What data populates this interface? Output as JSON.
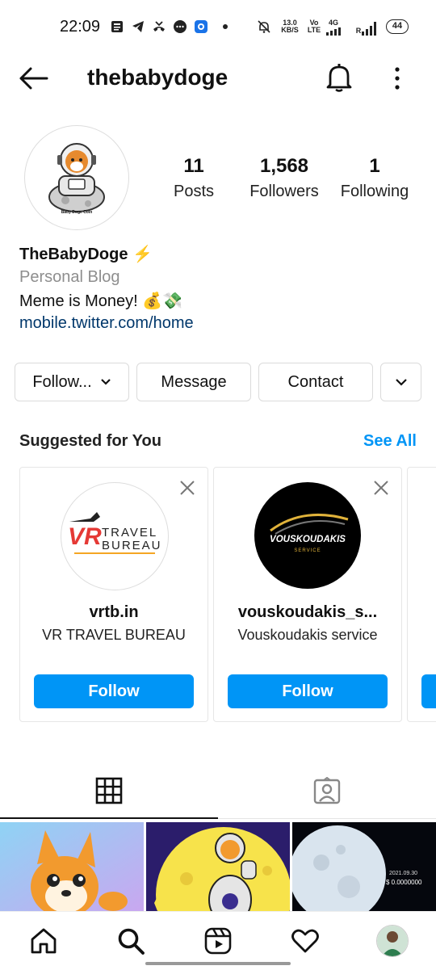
{
  "status_bar": {
    "time": "22:09",
    "speed_value": "13.0",
    "speed_unit": "KB/S",
    "volte_top": "Vo",
    "volte_bottom": "LTE",
    "net": "4G",
    "roaming": "R",
    "battery": "44"
  },
  "header": {
    "username": "thebabydoge"
  },
  "profile": {
    "avatar_caption": "Baby Doge Coin",
    "stats": [
      {
        "number": "11",
        "label": "Posts"
      },
      {
        "number": "1,568",
        "label": "Followers"
      },
      {
        "number": "1",
        "label": "Following"
      }
    ],
    "name": "TheBabyDoge",
    "name_emoji": "⚡",
    "category": "Personal Blog",
    "bio": "Meme is Money!",
    "bio_emoji": "💰💸",
    "link": "mobile.twitter.com/home"
  },
  "actions": {
    "follow_label": "Follow...",
    "message_label": "Message",
    "contact_label": "Contact"
  },
  "suggested": {
    "title": "Suggested for You",
    "see_all": "See All",
    "cards": [
      {
        "username": "vrtb.in",
        "subtitle": "VR TRAVEL BUREAU",
        "follow_label": "Follow",
        "logo_line1": "TRAVEL",
        "logo_line2": "BUREAU",
        "logo_mark": "VR"
      },
      {
        "username": "vouskoudakis_s...",
        "subtitle": "Vouskoudakis service",
        "follow_label": "Follow",
        "logo_line1": "VOUSKOUDAKIS",
        "logo_line2": "SERVICE"
      }
    ]
  },
  "grid": {
    "thumb3_date": "2021.09.30",
    "thumb3_price": "$ 0.0000000"
  },
  "colors": {
    "accent": "#0095f6",
    "link": "#00376b",
    "muted": "#8e8e8e"
  }
}
